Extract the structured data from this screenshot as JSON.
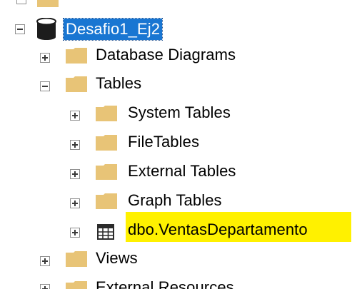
{
  "tree": {
    "database": {
      "label": "Desafio1_Ej2",
      "state": "expanded",
      "icon": "database-icon"
    },
    "items": [
      {
        "label": "Database Diagrams",
        "state": "collapsed",
        "icon": "folder-icon"
      },
      {
        "label": "Tables",
        "state": "expanded",
        "icon": "folder-icon"
      },
      {
        "label": "System Tables",
        "state": "collapsed",
        "icon": "folder-icon"
      },
      {
        "label": "FileTables",
        "state": "collapsed",
        "icon": "folder-icon"
      },
      {
        "label": "External Tables",
        "state": "collapsed",
        "icon": "folder-icon"
      },
      {
        "label": "Graph Tables",
        "state": "collapsed",
        "icon": "folder-icon"
      },
      {
        "label": "dbo.VentasDepartamento",
        "state": "collapsed",
        "icon": "table-icon",
        "highlight": "#fff100"
      },
      {
        "label": "Views",
        "state": "collapsed",
        "icon": "folder-icon"
      },
      {
        "label": "External Resources",
        "state": "collapsed",
        "icon": "folder-icon"
      }
    ]
  },
  "colors": {
    "selection": "#1976d2",
    "highlight": "#fff100",
    "folder": "#e8c477"
  }
}
